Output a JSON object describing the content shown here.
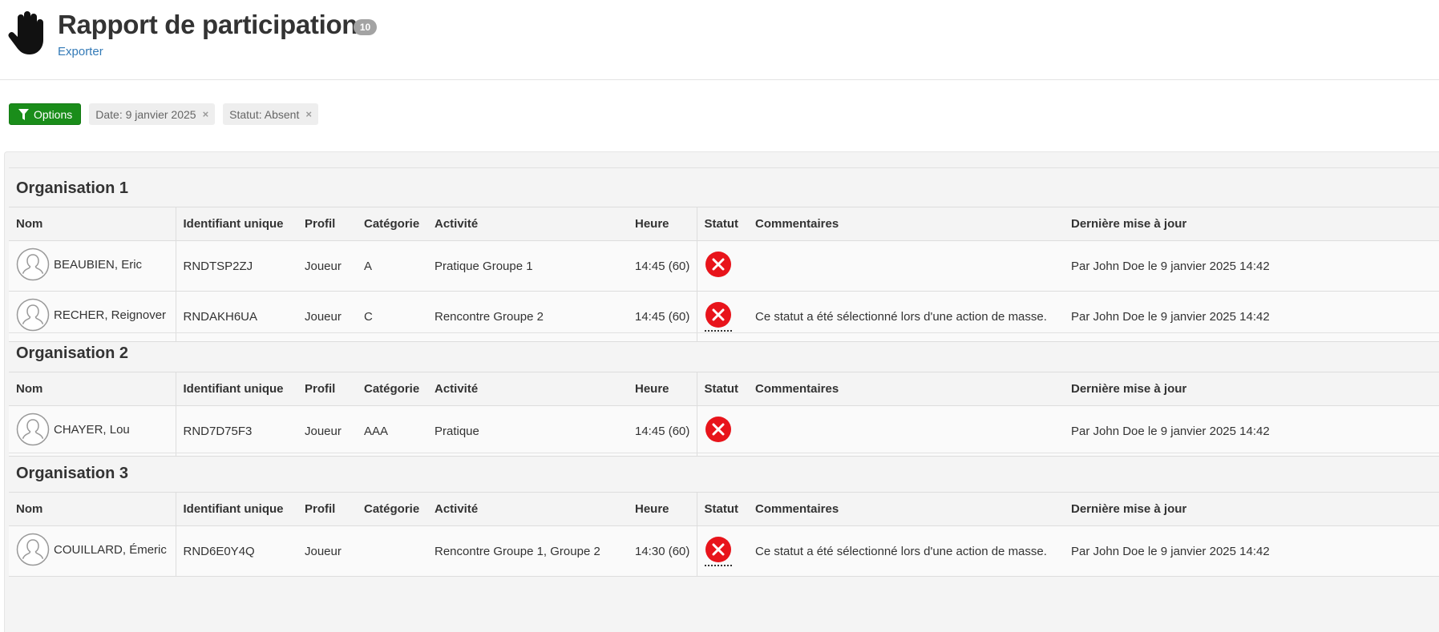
{
  "page": {
    "title": "Rapport de participation",
    "count": "10",
    "export_label": "Exporter"
  },
  "filters": {
    "options_label": "Options",
    "chips": [
      {
        "label": "Date: 9 janvier 2025"
      },
      {
        "label": "Statut: Absent"
      }
    ],
    "remove_symbol": "×"
  },
  "columns": {
    "name": "Nom",
    "id": "Identifiant unique",
    "profile": "Profil",
    "category": "Catégorie",
    "activity": "Activité",
    "time": "Heure",
    "status": "Statut",
    "comments": "Commentaires",
    "updated": "Dernière mise à jour"
  },
  "colors": {
    "status_absent": "#e8141b",
    "options_button": "#1a8d1a",
    "link": "#337ab7"
  },
  "organisations": [
    {
      "title": "Organisation 1",
      "rows": [
        {
          "name": "BEAUBIEN, Eric",
          "id": "RNDTSP2ZJ",
          "profile": "Joueur",
          "category": "A",
          "activity": "Pratique Groupe 1",
          "time": "14:45 (60)",
          "status": "absent",
          "comment": "",
          "updated": "Par John Doe le 9 janvier 2025 14:42"
        },
        {
          "name": "RECHER, Reignover",
          "id": "RNDAKH6UA",
          "profile": "Joueur",
          "category": "C",
          "activity": "Rencontre Groupe 2",
          "time": "14:45 (60)",
          "status": "absent",
          "comment": "Ce statut a été sélectionné lors d'une action de masse.",
          "updated": "Par John Doe le 9 janvier 2025 14:42"
        }
      ]
    },
    {
      "title": "Organisation 2",
      "rows": [
        {
          "name": "CHAYER, Lou",
          "id": "RND7D75F3",
          "profile": "Joueur",
          "category": "AAA",
          "activity": "Pratique",
          "time": "14:45 (60)",
          "status": "absent",
          "comment": "",
          "updated": "Par John Doe le 9 janvier 2025 14:42"
        }
      ]
    },
    {
      "title": "Organisation 3",
      "rows": [
        {
          "name": "COUILLARD, Émeric",
          "id": "RND6E0Y4Q",
          "profile": "Joueur",
          "category": "",
          "activity": "Rencontre Groupe 1, Groupe 2",
          "time": "14:30 (60)",
          "status": "absent",
          "comment": "Ce statut a été sélectionné lors d'une action de masse.",
          "updated": "Par John Doe le 9 janvier 2025 14:42"
        }
      ]
    }
  ]
}
